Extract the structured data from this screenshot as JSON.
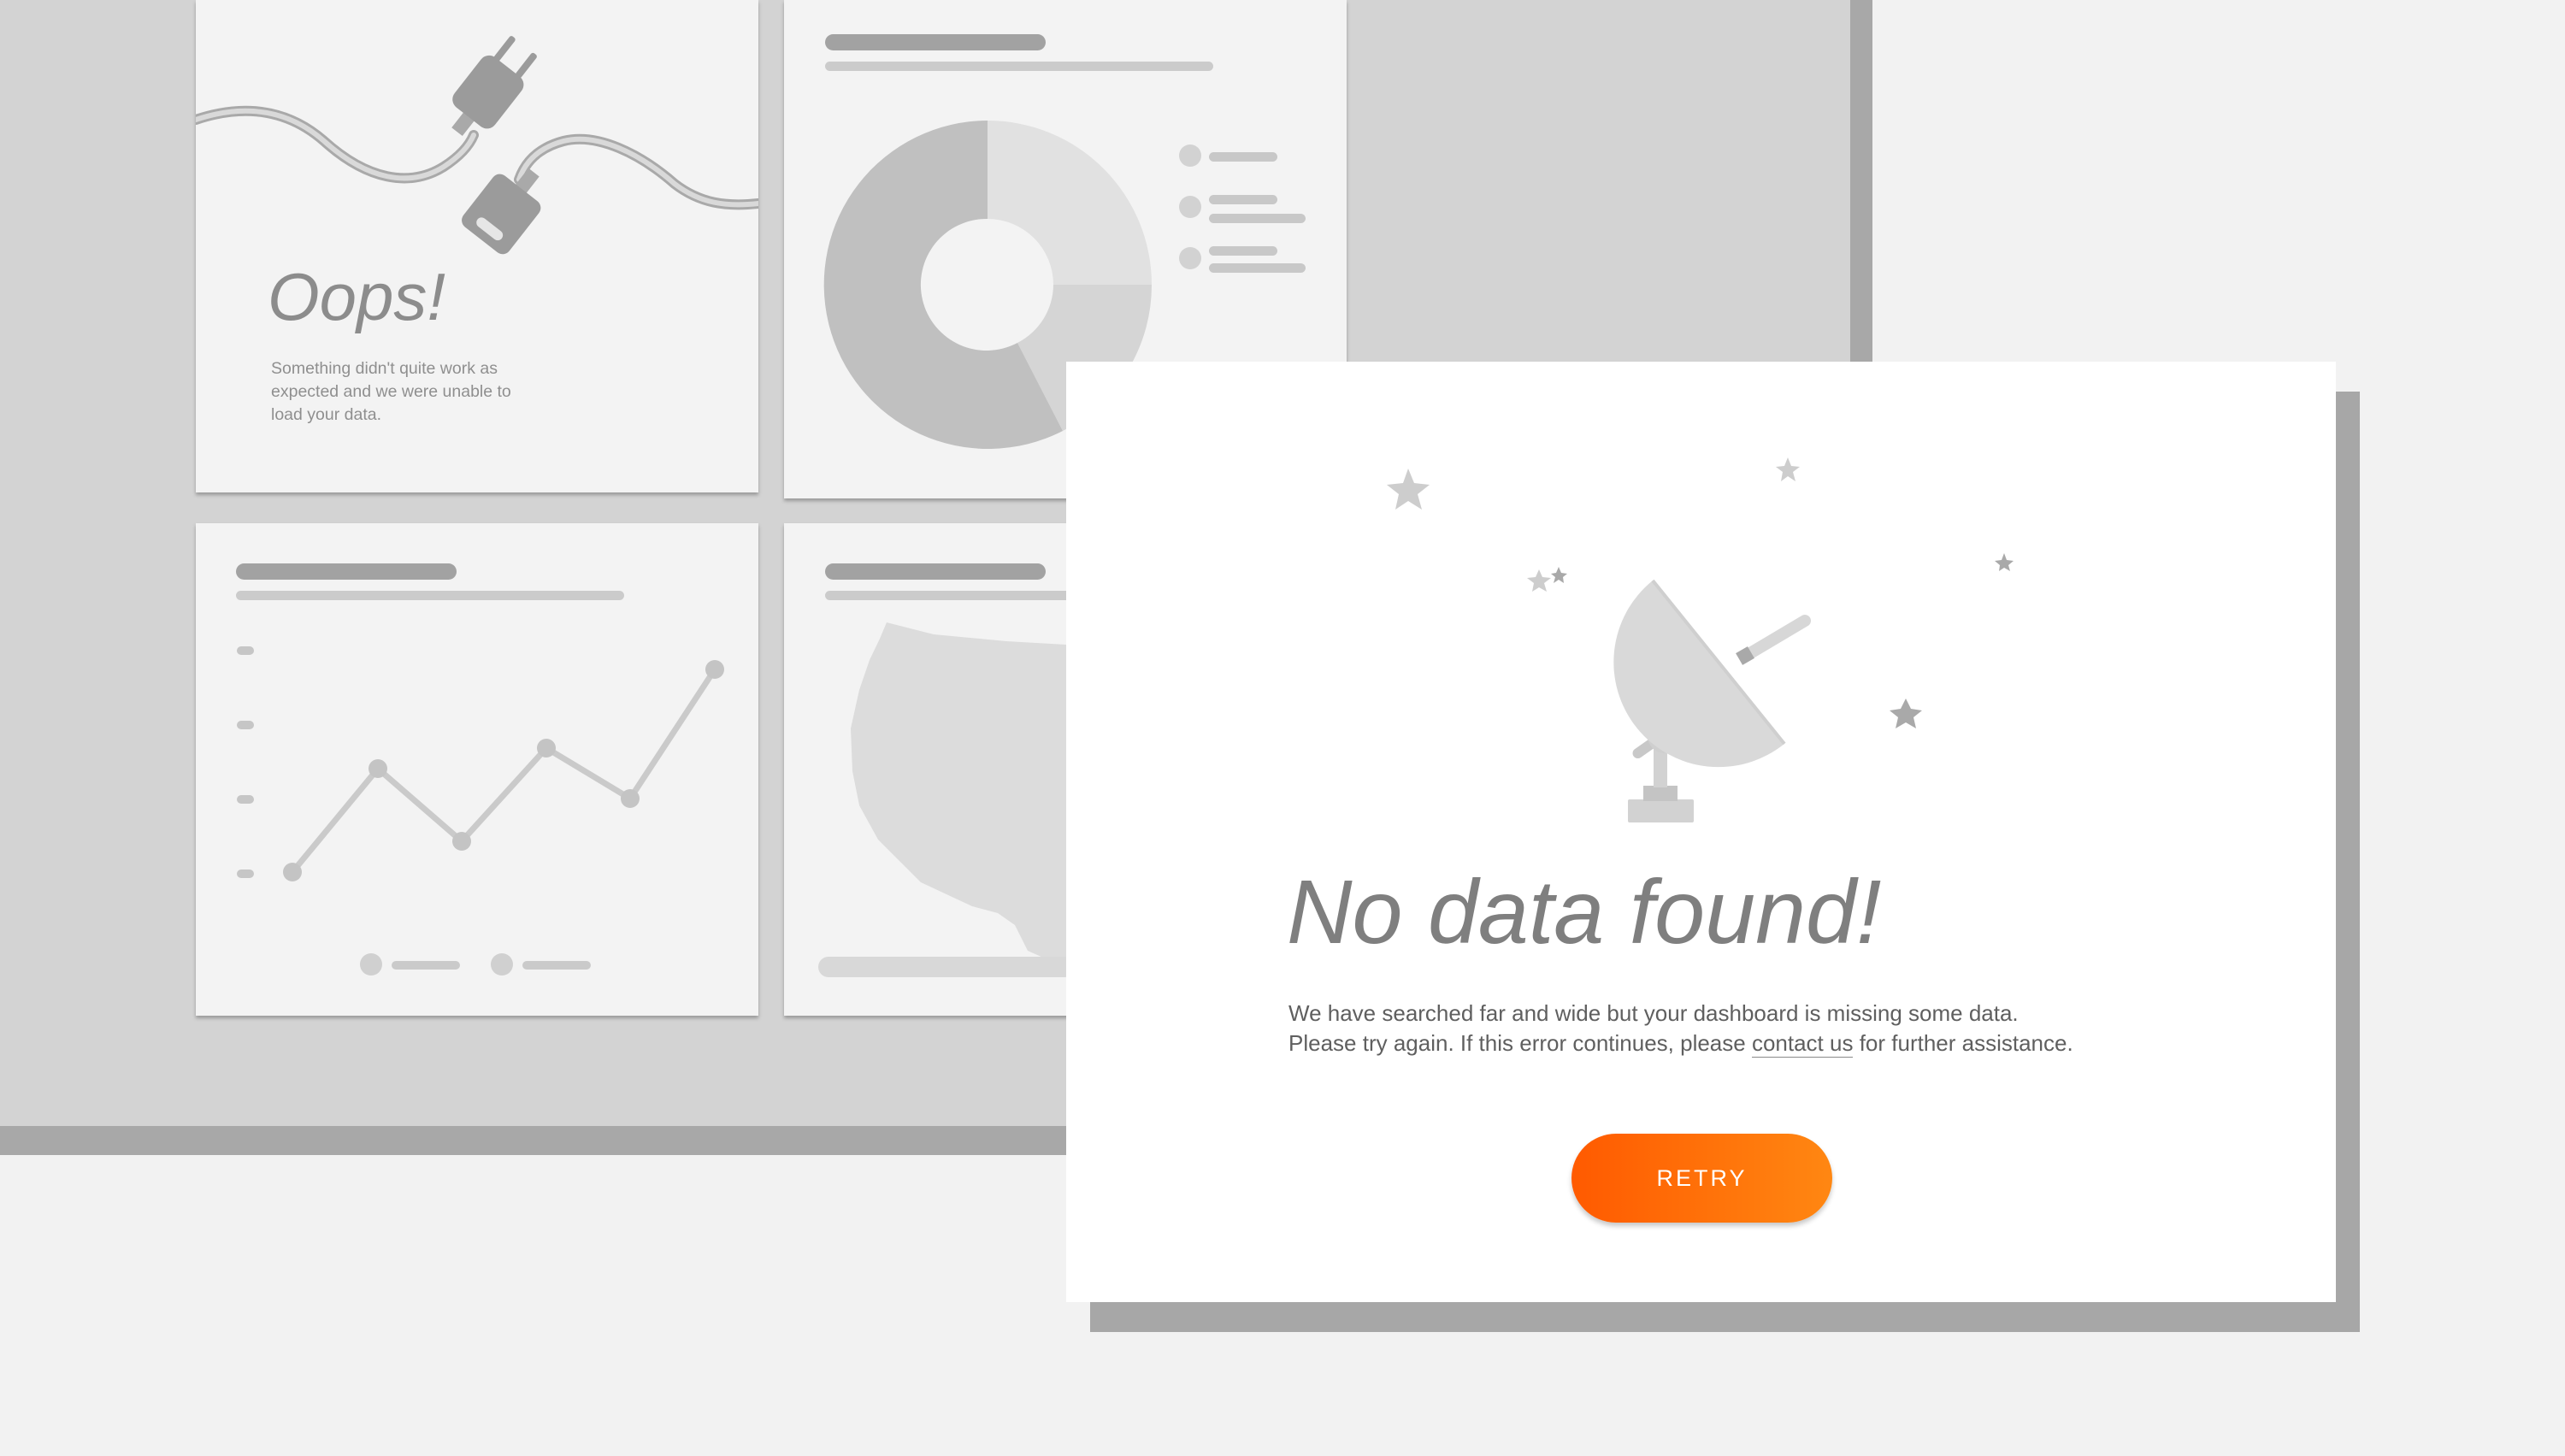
{
  "dashboard": {
    "error_card": {
      "title": "Oops!",
      "message": "Something didn't quite work as expected and we were unable to load your data."
    }
  },
  "modal": {
    "title": "No data found!",
    "message_line1": "We have searched far and wide but your dashboard is missing some data.",
    "message_line2_before": "Please try again. If this error continues, please ",
    "contact_link": "contact us",
    "message_line2_after": " for further assistance.",
    "retry_label": "RETRY"
  },
  "colors": {
    "accent_start": "#ff5a00",
    "accent_end": "#ff8712"
  },
  "icons": [
    "unplugged-cable-icon",
    "satellite-dish-icon",
    "star-icon"
  ]
}
